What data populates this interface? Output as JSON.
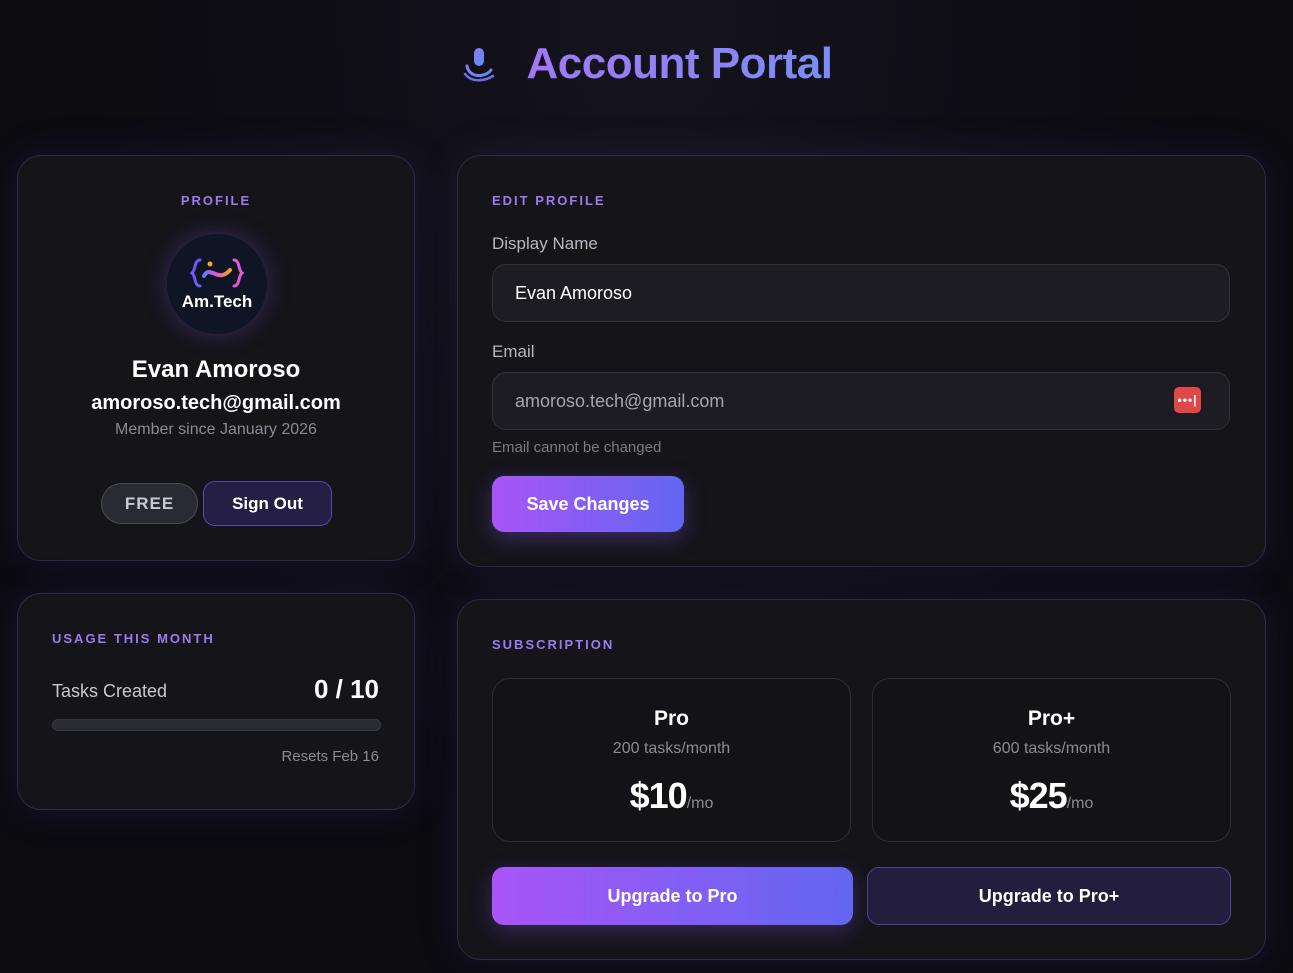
{
  "header": {
    "title": "Account Portal",
    "logo_icon": "microphone-hand-icon"
  },
  "profile": {
    "section_label": "PROFILE",
    "avatar_text": "Am.Tech",
    "avatar_icon": "code-braces-logo",
    "name": "Evan Amoroso",
    "email": "amoroso.tech@gmail.com",
    "member_since": "Member since January 2026",
    "plan_badge": "FREE",
    "sign_out_label": "Sign Out"
  },
  "usage": {
    "section_label": "USAGE THIS MONTH",
    "tasks_label": "Tasks Created",
    "tasks_value": "0 / 10",
    "tasks_used": 0,
    "tasks_limit": 10,
    "reset_text": "Resets Feb 16"
  },
  "edit_profile": {
    "section_label": "EDIT PROFILE",
    "display_name_label": "Display Name",
    "display_name_value": "Evan Amoroso",
    "email_label": "Email",
    "email_value": "amoroso.tech@gmail.com",
    "email_hint": "Email cannot be changed",
    "password_manager_icon": "password-dots-icon",
    "save_label": "Save Changes"
  },
  "subscription": {
    "section_label": "SUBSCRIPTION",
    "plans": [
      {
        "name": "Pro",
        "tasks": "200 tasks/month",
        "price": "$10",
        "per": "/mo",
        "button": "Upgrade to Pro"
      },
      {
        "name": "Pro+",
        "tasks": "600 tasks/month",
        "price": "$25",
        "per": "/mo",
        "button": "Upgrade to Pro+"
      }
    ]
  },
  "colors": {
    "accent_start": "#a855f7",
    "accent_end": "#6366f1",
    "label_purple": "#9a7cf0",
    "background": "#0b0b10",
    "card": "#141419",
    "danger_icon": "#e04848"
  }
}
